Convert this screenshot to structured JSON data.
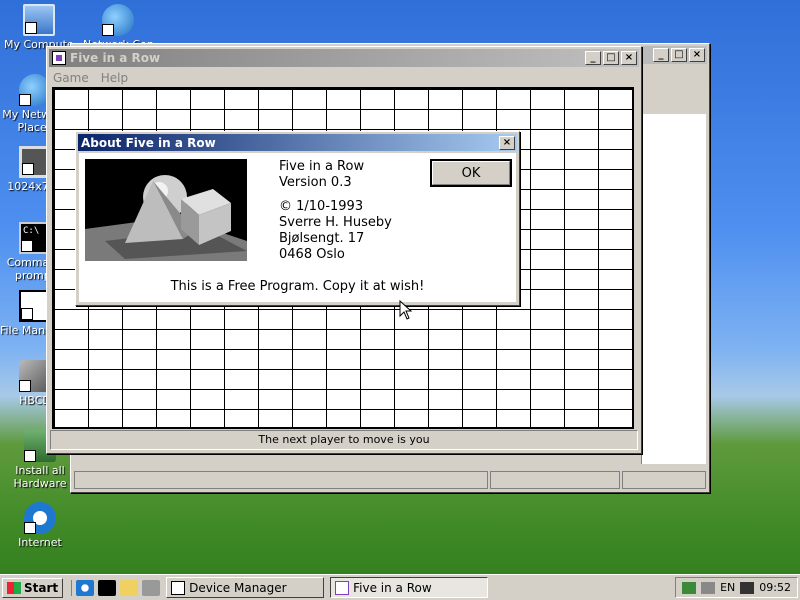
{
  "desktop": {
    "icons": [
      {
        "label": "My Computer",
        "icon": "my-computer-icon"
      },
      {
        "label": "Network Connections",
        "icon": "network-connections-icon"
      },
      {
        "label": "My Network Places",
        "icon": "network-places-icon"
      },
      {
        "label": "1024x768",
        "icon": "display-icon"
      },
      {
        "label": "Command prompt",
        "icon": "command-prompt-icon"
      },
      {
        "label": "File Manager",
        "icon": "file-manager-icon"
      },
      {
        "label": "HBCD",
        "icon": "hbcd-icon"
      },
      {
        "label": "Install all Hardware",
        "icon": "hardware-icon"
      },
      {
        "label": "Internet",
        "icon": "internet-explorer-icon"
      }
    ]
  },
  "back_window": {
    "title": ""
  },
  "game_window": {
    "title": "Five in a Row",
    "menu": [
      "Game",
      "Help"
    ],
    "status": "The next player to move is you",
    "buttons": {
      "minimize": "_",
      "maximize": "□",
      "close": "×"
    }
  },
  "about_dialog": {
    "title": "About Five in a Row",
    "close": "×",
    "name": "Five in a Row",
    "version": "Version 0.3",
    "copyright": "© 1/10-1993",
    "author": "Sverre H. Huseby",
    "street": "Bjølsengt. 17",
    "city": "0468 Oslo",
    "notice": "This is a Free Program. Copy it at wish!",
    "ok_label": "OK"
  },
  "taskbar": {
    "start_label": "Start",
    "tasks": [
      {
        "label": "Device Manager",
        "active": false
      },
      {
        "label": "Five in a Row",
        "active": true
      }
    ],
    "tray": {
      "language": "EN",
      "time": "09:52"
    }
  },
  "colors": {
    "title_active": "#0a246a",
    "face": "#d4d0c8"
  }
}
